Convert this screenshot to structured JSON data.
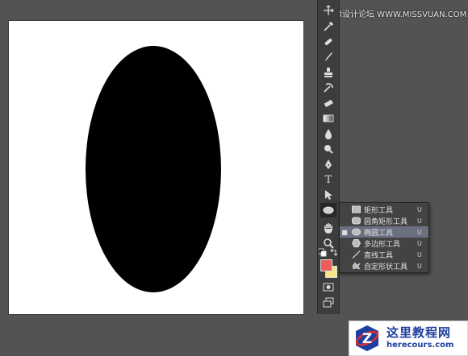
{
  "watermark": {
    "text": "思缘设计论坛 WWW.MISSVUAN.COM"
  },
  "canvas": {
    "background": "#ffffff",
    "shape_fill": "#000000"
  },
  "toolbar": {
    "icons": [
      "move-icon",
      "eyedropper-icon",
      "spot-healing-icon",
      "brush-icon",
      "clone-stamp-icon",
      "history-brush-icon",
      "eraser-icon",
      "gradient-icon",
      "blur-icon",
      "dodge-icon",
      "pen-icon",
      "type-icon",
      "path-selection-icon",
      "ellipse-tool-icon",
      "hand-icon",
      "zoom-icon",
      "default-colors-icon",
      "swap-colors-icon",
      "quick-mask-icon",
      "screen-mode-icon"
    ],
    "type_glyph": "T",
    "foreground_color": "#ed5d5b",
    "background_color": "#f5e58b"
  },
  "flyout": {
    "items": [
      {
        "label": "矩形工具",
        "shortcut": "U",
        "icon": "rectangle-icon",
        "selected": false
      },
      {
        "label": "圆角矩形工具",
        "shortcut": "U",
        "icon": "rounded-rectangle-icon",
        "selected": false
      },
      {
        "label": "椭圆工具",
        "shortcut": "U",
        "icon": "ellipse-icon",
        "selected": true
      },
      {
        "label": "多边形工具",
        "shortcut": "U",
        "icon": "polygon-icon",
        "selected": false
      },
      {
        "label": "直线工具",
        "shortcut": "U",
        "icon": "line-icon",
        "selected": false
      },
      {
        "label": "自定形状工具",
        "shortcut": "U",
        "icon": "custom-shape-icon",
        "selected": false
      }
    ],
    "selected_marker": "■"
  },
  "logo": {
    "title": "这里教程网",
    "url": "herecours.com",
    "badge_letter": "Z"
  }
}
